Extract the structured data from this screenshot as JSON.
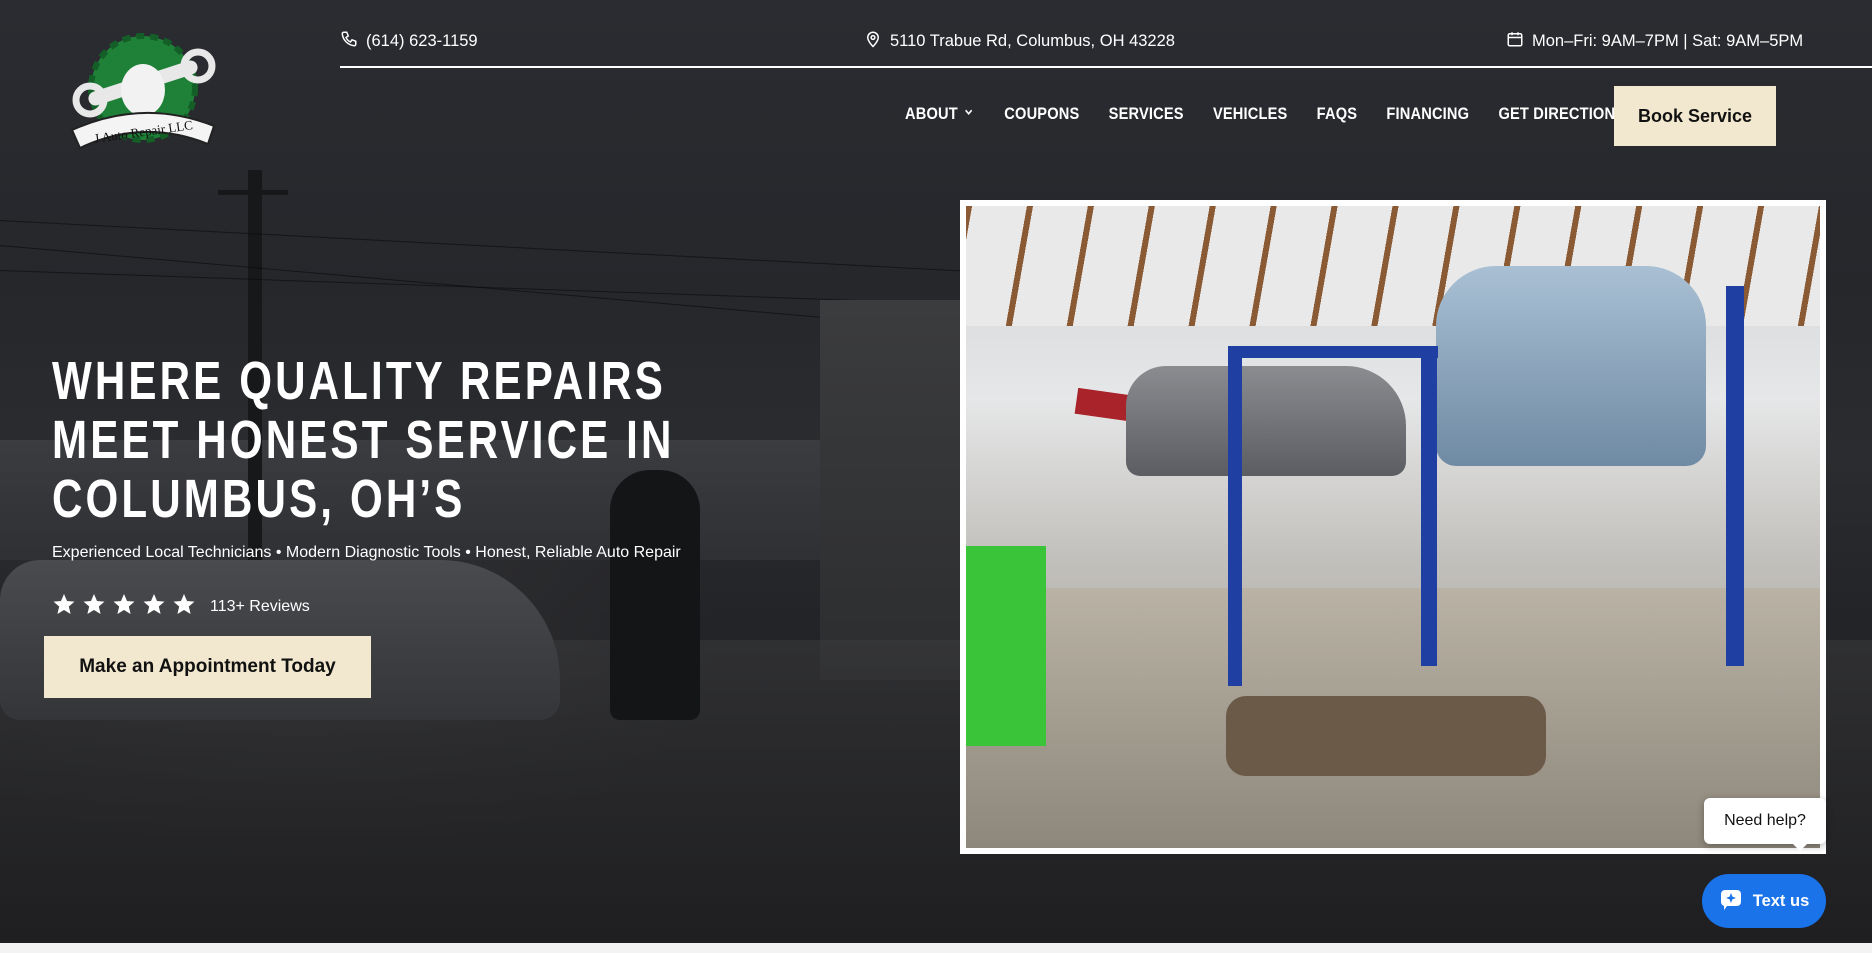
{
  "brand": {
    "logo_text": "J Auto Repair LLC",
    "accent_green": "#1e8b3a",
    "cream": "#f2e8cf"
  },
  "topbar": {
    "phone": "(614) 623-1159",
    "phone_icon": "phone-icon",
    "address": "5110 Trabue Rd, Columbus, OH 43228",
    "address_icon": "map-pin-icon",
    "hours": "Mon–Fri: 9AM–7PM | Sat: 9AM–5PM",
    "hours_icon": "calendar-icon"
  },
  "nav": {
    "items": [
      {
        "label": "ABOUT"
      },
      {
        "label": "COUPONS"
      },
      {
        "label": "SERVICES"
      },
      {
        "label": "VEHICLES"
      },
      {
        "label": "FAQS"
      },
      {
        "label": "FINANCING"
      },
      {
        "label": "GET DIRECTIONS"
      }
    ],
    "book_label": "Book Service"
  },
  "hero": {
    "headline_lines": [
      "WHERE QUALITY REPAIRS",
      "MEET HONEST SERVICE IN",
      "COLUMBUS, OH’S"
    ],
    "tagline": "Experienced Local Technicians • Modern Diagnostic Tools • Honest, Reliable Auto Repair",
    "stars": 5,
    "reviews_label": "113+ Reviews",
    "cta_label": "Make an Appointment Today"
  },
  "chat": {
    "need_help": "Need help?",
    "text_us": "Text us",
    "button_color": "#1a73e8"
  }
}
